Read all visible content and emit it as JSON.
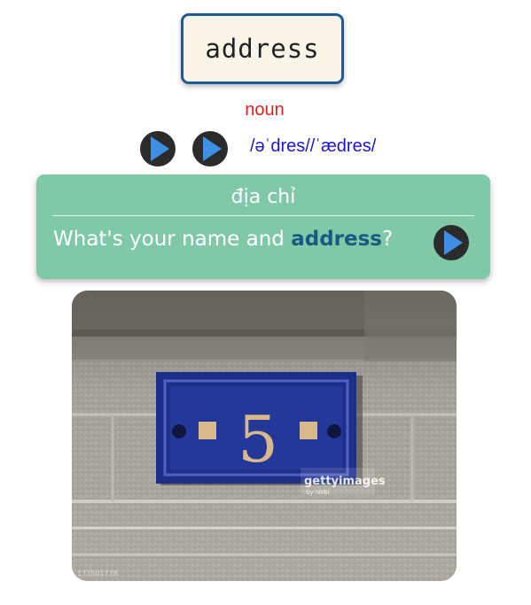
{
  "word": "address",
  "part_of_speech": "noun",
  "phonetic": "/əˈdres//ˈædres/",
  "meaning": "địa chỉ",
  "example": {
    "before": "What's your name and ",
    "keyword": "address",
    "after": "?"
  },
  "audio_buttons": [
    {
      "icon": "play-icon"
    },
    {
      "icon": "play-icon"
    },
    {
      "icon": "play-icon"
    }
  ],
  "photo": {
    "plaque_number": "5",
    "watermark": "gettyimages",
    "watermark_sub": "by IWBI",
    "corner_id": "173501728"
  },
  "colors": {
    "word_border": "#1d5a96",
    "word_bg": "#f8f5e8",
    "pos_text": "#e31d1d",
    "phonetic_text": "#1c16d6",
    "card_bg": "#7fc9a8",
    "keyword": "#185a82",
    "play_triangle": "#3d8fe6",
    "play_circle": "#2b2b2b"
  }
}
